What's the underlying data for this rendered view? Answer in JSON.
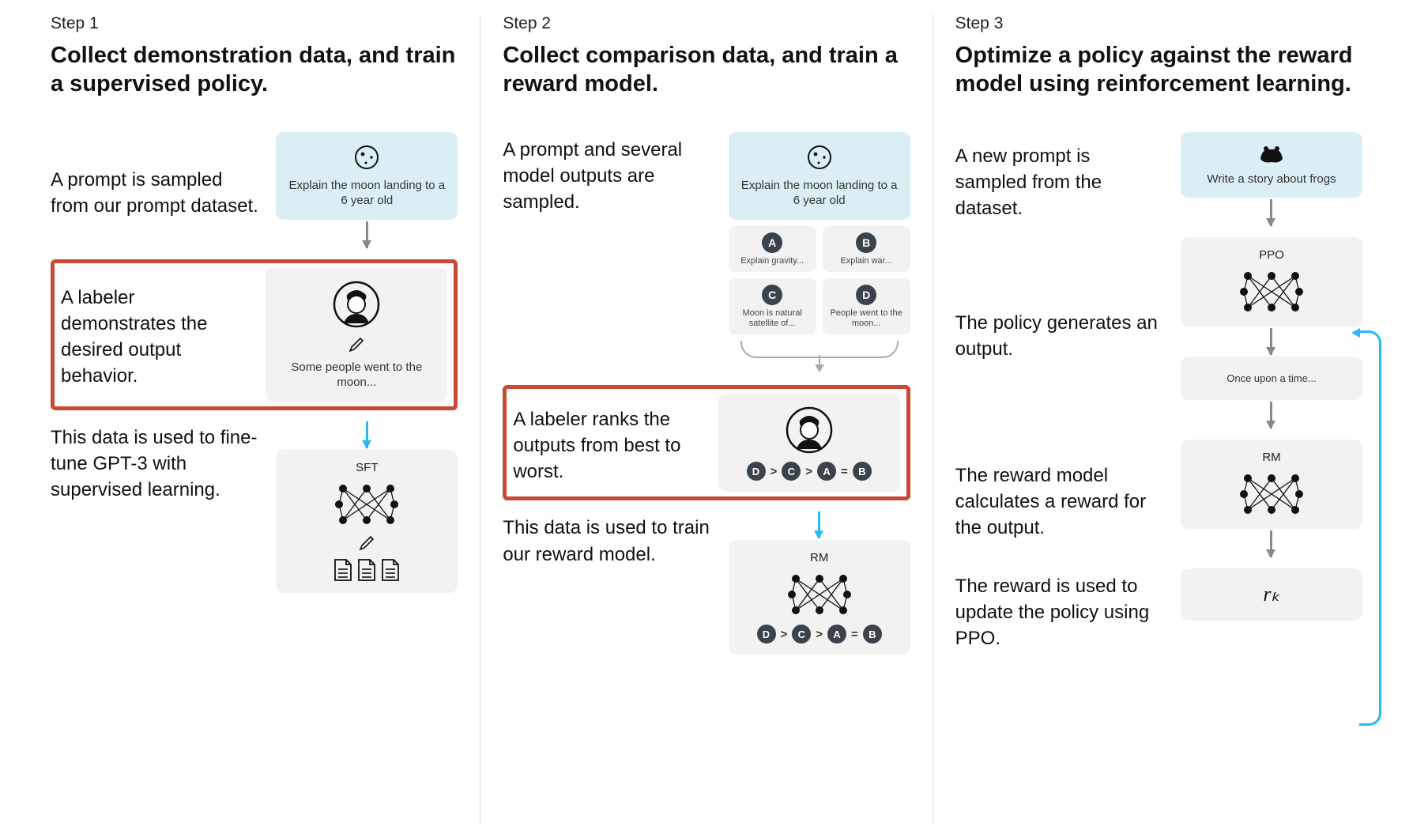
{
  "step1": {
    "label": "Step 1",
    "title": "Collect demonstration data, and train a supervised policy.",
    "prompt_desc": "A prompt is sampled from our prompt dataset.",
    "prompt_text": "Explain the moon landing to a 6 year old",
    "labeler_desc": "A labeler demonstrates the desired output behavior.",
    "labeler_text": "Some people went to the moon...",
    "train_desc": "This data is used to fine-tune GPT-3 with supervised learning.",
    "model_label": "SFT"
  },
  "step2": {
    "label": "Step 2",
    "title": "Collect comparison data, and train a reward model.",
    "prompt_desc": "A prompt and several model outputs are sampled.",
    "prompt_text": "Explain the moon landing to a 6 year old",
    "options": [
      {
        "id": "A",
        "text": "Explain gravity..."
      },
      {
        "id": "B",
        "text": "Explain war..."
      },
      {
        "id": "C",
        "text": "Moon is natural satellite of..."
      },
      {
        "id": "D",
        "text": "People went to the moon..."
      }
    ],
    "rank_desc": "A labeler ranks the outputs from best to worst.",
    "ranking": [
      "D",
      ">",
      "C",
      ">",
      "A",
      "=",
      "B"
    ],
    "train_desc": "This data is used to train our reward model.",
    "model_label": "RM"
  },
  "step3": {
    "label": "Step 3",
    "title": "Optimize a policy against the reward model using reinforcement learning.",
    "prompt_desc": "A new prompt is sampled from the dataset.",
    "prompt_text": "Write a story about frogs",
    "policy_desc": "The policy generates an output.",
    "ppo_label": "PPO",
    "output_text": "Once upon a time...",
    "rm_desc": "The reward model calculates a reward for the output.",
    "rm_label": "RM",
    "reward_token": "rₖ",
    "update_desc": "The reward is used to update the policy using PPO."
  }
}
